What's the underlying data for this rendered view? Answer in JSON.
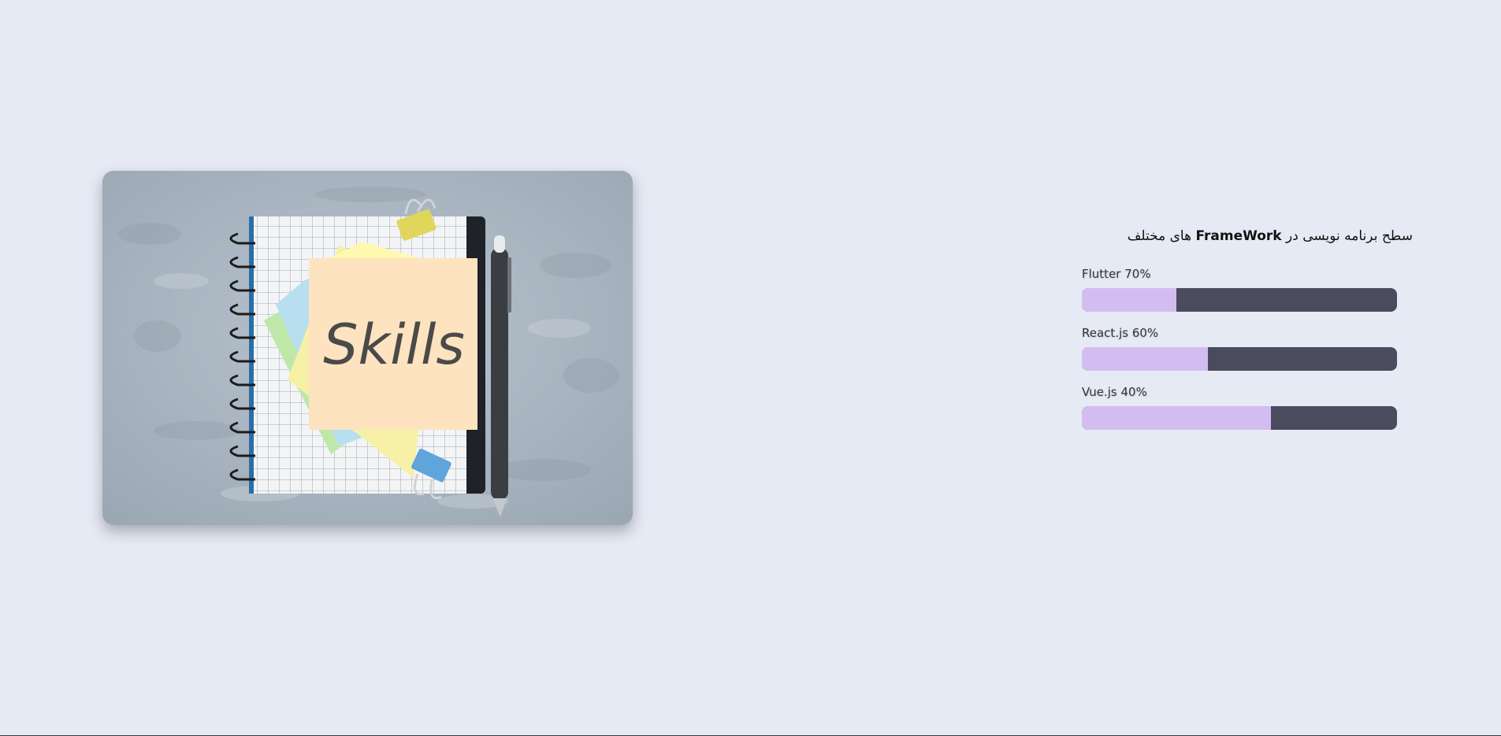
{
  "colors": {
    "page_background": "#e6eaf5",
    "bar_track": "#4a4c5e",
    "bar_fill": "#d3bdf0"
  },
  "image": {
    "note_text": "Skills"
  },
  "skills_panel": {
    "title_prefix": "سطح برنامه نویسی در ",
    "title_bold": "FrameWork",
    "title_suffix": " های مختلف",
    "items": [
      {
        "label": "Flutter 70%",
        "level_fill_fraction": 0.3
      },
      {
        "label": "React.js 60%",
        "level_fill_fraction": 0.4
      },
      {
        "label": "Vue.js 40%",
        "level_fill_fraction": 0.6
      }
    ]
  }
}
